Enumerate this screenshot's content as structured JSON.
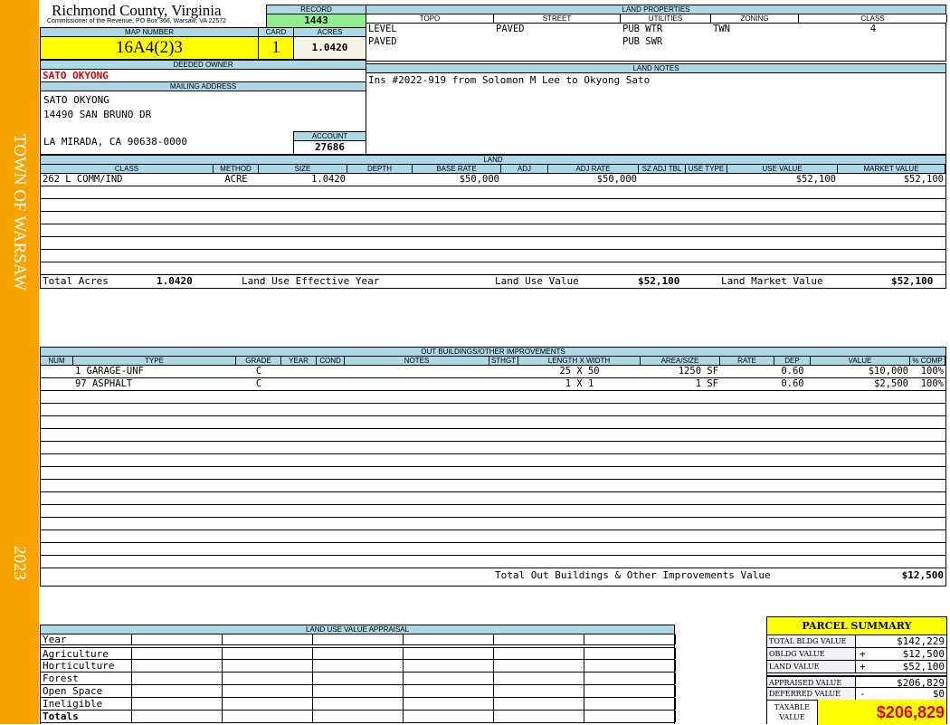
{
  "sidebar": {
    "town": "TOWN OF WARSAW",
    "year": "2023"
  },
  "header": {
    "title": "Richmond County, Virginia",
    "subtitle": "Commissioner of the Revenue, PO Box 366, Warsaw, VA 22572"
  },
  "record": {
    "label": "RECORD",
    "value": "1443"
  },
  "map": {
    "label": "MAP NUMBER",
    "value": "16A4(2)3",
    "card_label": "CARD",
    "card": "1",
    "acres_label": "ACRES",
    "acres": "1.0420"
  },
  "owner": {
    "label": "DEEDED OWNER",
    "name": "SATO OKYONG",
    "mailing_label": "MAILING ADDRESS",
    "address": [
      "SATO OKYONG",
      "14490 SAN BRUNO DR",
      "",
      "LA MIRADA, CA 90638-0000"
    ],
    "account_label": "ACCOUNT",
    "account": "27686"
  },
  "land_properties": {
    "label": "LAND PROPERTIES",
    "columns": [
      "TOPO",
      "STREET",
      "UTILITIES",
      "ZONING",
      "CLASS"
    ],
    "rows": [
      [
        "LEVEL",
        "PAVED",
        "PUB WTR",
        "TWN",
        "4"
      ],
      [
        "PAVED",
        "",
        "PUB SWR",
        "",
        ""
      ]
    ]
  },
  "land_notes": {
    "label": "LAND NOTES",
    "text": "Ins #2022-919 from Solomon M Lee to Okyong Sato"
  },
  "land": {
    "label": "LAND",
    "columns": [
      "CLASS",
      "METHOD",
      "SIZE",
      "DEPTH",
      "BASE RATE",
      "ADJ",
      "ADJ RATE",
      "SZ ADJ TBL",
      "USE TYPE",
      "USE VALUE",
      "MARKET VALUE"
    ],
    "rows": [
      [
        "262 L COMM/IND",
        "ACRE",
        "1.0420",
        "",
        "$50,000",
        "",
        "$50,000",
        "",
        "",
        "$52,100",
        "$52,100"
      ]
    ],
    "totals": {
      "acres_label": "Total Acres",
      "acres": "1.0420",
      "year_label": "Land Use Effective Year",
      "year": "",
      "use_label": "Land Use Value",
      "use": "$52,100",
      "market_label": "Land Market Value",
      "market": "$52,100"
    }
  },
  "outbuildings": {
    "label": "OUT BUILDINGS/OTHER IMPROVEMENTS",
    "columns": [
      "NUM",
      "TYPE",
      "GRADE",
      "YEAR",
      "COND",
      "NOTES",
      "STHGT",
      "LENGTH X WIDTH",
      "AREA/SIZE",
      "RATE",
      "DEP",
      "VALUE",
      "% COMP"
    ],
    "rows": [
      [
        "",
        "1 GARAGE-UNF",
        "C",
        "",
        "",
        "",
        "",
        "25 X 50",
        "1250 SF",
        "",
        "0.60",
        "$10,000",
        "100%"
      ],
      [
        "",
        "97 ASPHALT",
        "C",
        "",
        "",
        "",
        "",
        "1 X 1",
        "1 SF",
        "",
        "0.60",
        "$2,500",
        "100%"
      ]
    ],
    "total_label": "Total Out Buildings & Other Improvements Value",
    "total": "$12,500"
  },
  "land_use_appraisal": {
    "label": "LAND USE VALUE APPRAISAL",
    "year_label": "Year",
    "rows": [
      "Agriculture",
      "Horticulture",
      "Forest",
      "Open Space",
      "Ineligible"
    ],
    "totals_label": "Totals"
  },
  "parcel_summary": {
    "label": "PARCEL SUMMARY",
    "rows": [
      {
        "label": "TOTAL BLDG VALUE",
        "op": "",
        "value": "$142,229"
      },
      {
        "label": "OBLDG VALUE",
        "op": "+",
        "value": "$12,500"
      },
      {
        "label": "LAND VALUE",
        "op": "+",
        "value": "$52,100"
      },
      {
        "label": "APPRAISED VALUE",
        "op": "",
        "value": "$206,829"
      },
      {
        "label": "DEFERRED VALUE",
        "op": "-",
        "value": "$0"
      }
    ],
    "taxable_label": "TAXABLE VALUE",
    "taxable": "$206,829"
  },
  "colors": {
    "sidebar": "#f7a300",
    "header_bg": "#add8e6",
    "record_bg": "#90ee90",
    "highlight": "#ffff00",
    "owner_text": "#e00000"
  }
}
